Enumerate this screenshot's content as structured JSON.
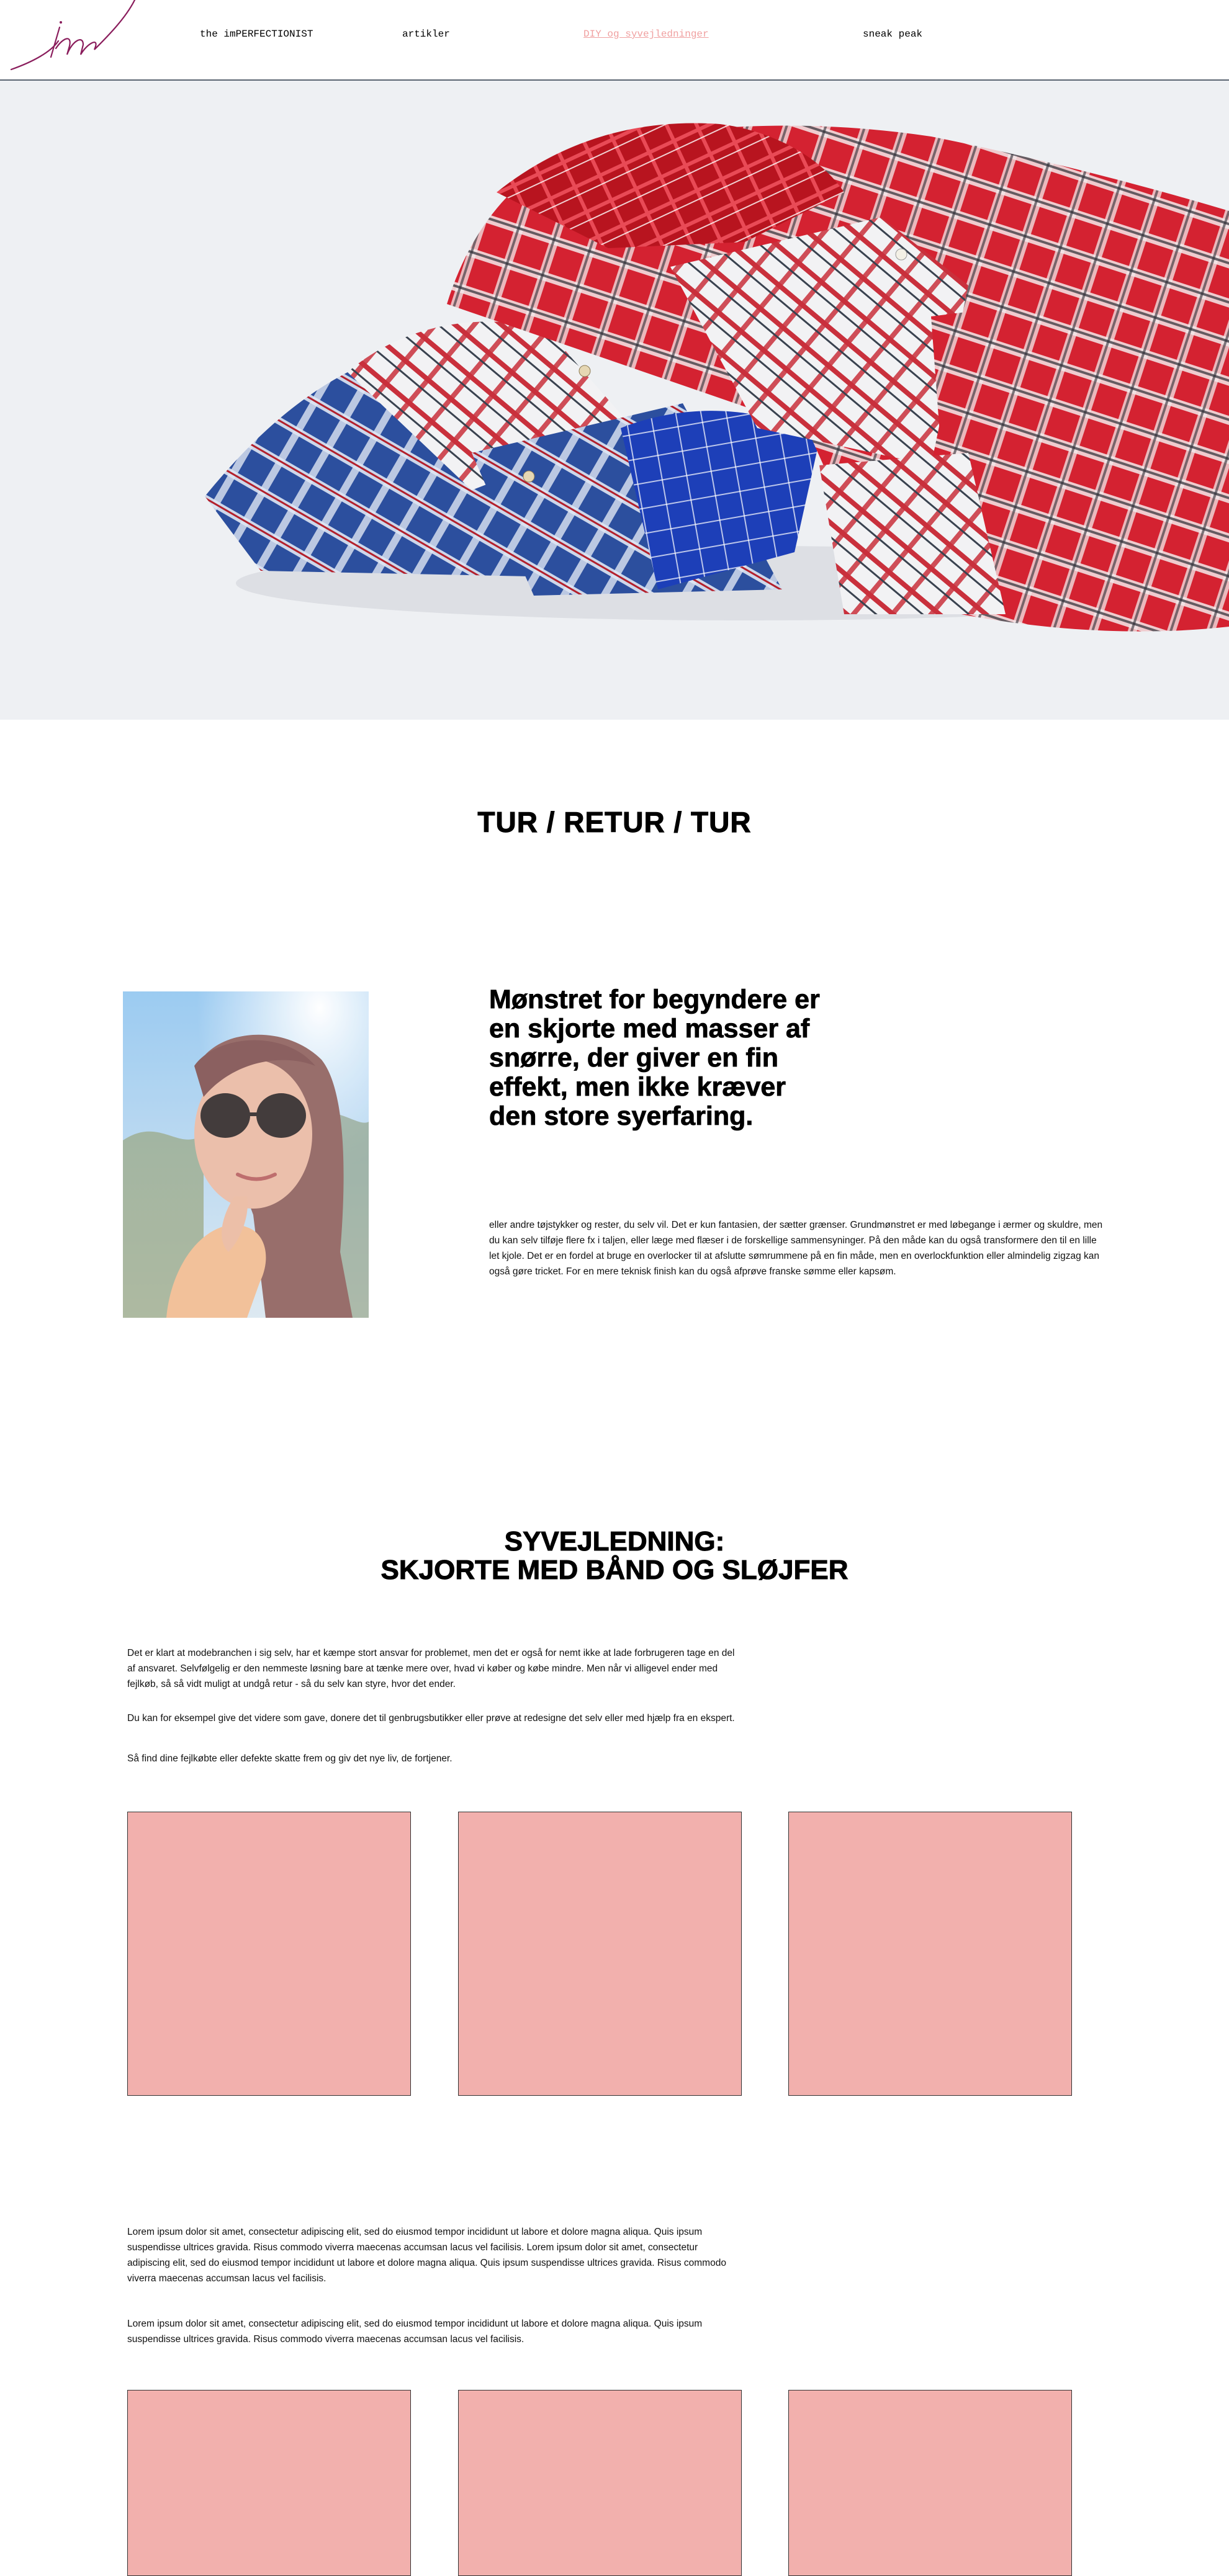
{
  "nav": {
    "logo_text": "im",
    "items": [
      {
        "label": "the imPERFECTIONIST",
        "active": false
      },
      {
        "label": "artikler",
        "active": false
      },
      {
        "label": "DIY og syvejledninger",
        "active": true
      },
      {
        "label": "sneak peak",
        "active": false
      }
    ]
  },
  "hero": {
    "image": "pile-of-plaid-shirts"
  },
  "section1": {
    "title": "TUR / RETUR / TUR",
    "quote": "Mønstret for begyndere er en skjorte med masser af snørre, der giver en fin effekt, men ikke kræver den store syerfaring.",
    "body": "eller andre tøjstykker og rester, du selv vil. Det er kun fantasien, der sætter grænser. Grundmønstret er med løbegange i ærmer og skuldre, men du kan selv tilføje flere fx i taljen, eller læge med flæser i de forskellige sammensyninger. På den måde kan du også transformere den til en lille let kjole. Det er en fordel at bruge en overlocker til at afslutte sømrummene på en fin måde, men en overlockfunktion eller almindelig zigzag kan også gøre tricket. For en mere teknisk finish kan du også afprøve franske sømme eller kapsøm."
  },
  "section2": {
    "title_line1": "SYVEJLEDNING:",
    "title_line2": "SKJORTE MED BÅND OG SLØJFER",
    "p1": "Det er klart at modebranchen i sig selv, har et kæmpe stort ansvar for problemet, men det er også for nemt ikke at lade forbrugeren tage en del af ansvaret. Selvfølgelig er den nemmeste løsning bare at tænke mere over, hvad vi køber og købe mindre. Men når vi alligevel ender med fejlkøb, så så vidt muligt at undgå retur - så  du selv kan styre, hvor det ender.",
    "p2": "Du kan for eksempel give det videre som gave, donere det til genbrugsbutikker eller prøve at redesigne det selv eller med hjælp fra en ekspert.",
    "p3": "Så find dine fejlkøbte eller defekte skatte frem og giv det nye liv, de fortjener.",
    "p4": "Lorem ipsum dolor sit amet, consectetur adipiscing elit, sed do eiusmod tempor incididunt ut labore et dolore magna aliqua. Quis ipsum suspendisse ultrices gravida. Risus commodo viverra maecenas accumsan lacus vel facilisis. Lorem ipsum dolor sit amet, consectetur adipiscing elit, sed do eiusmod tempor incididunt ut labore et dolore magna aliqua. Quis ipsum suspendisse ultrices gravida. Risus commodo viverra maecenas accumsan lacus vel facilisis.",
    "p5": "Lorem ipsum dolor sit amet, consectetur adipiscing elit, sed do eiusmod tempor incididunt ut labore et dolore magna aliqua. Quis ipsum suspendisse ultrices gravida. Risus commodo viverra maecenas accumsan lacus vel facilisis."
  },
  "colors": {
    "accent": "#f2b0ad",
    "active_nav": "#f0a0a0",
    "logo": "#8a1d5c"
  }
}
